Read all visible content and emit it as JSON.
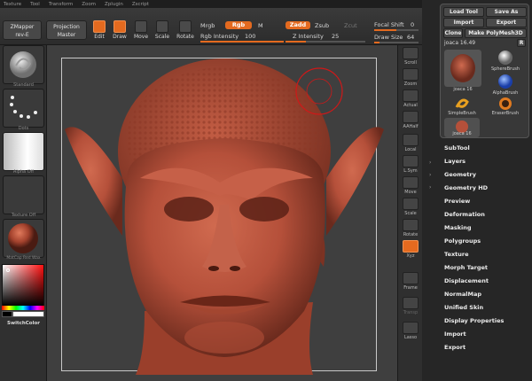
{
  "menubar": [
    "Texture",
    "Tool",
    "Transform",
    "Zoom",
    "Zplugin",
    "Zscript"
  ],
  "toolbar": {
    "zmapper": "ZMapper",
    "zmapper_sub": "rev-E",
    "projection": "Projection",
    "projection_sub": "Master",
    "edit": "Edit",
    "draw": "Draw",
    "move": "Move",
    "scale": "Scale",
    "rotate": "Rotate",
    "mrgb": "Mrgb",
    "rgb": "Rgb",
    "m": "M",
    "rgb_intensity_label": "Rgb Intensity",
    "rgb_intensity_value": "100",
    "rgb_intensity": 1.0,
    "zadd": "Zadd",
    "zsub": "Zsub",
    "zcut": "Zcut",
    "z_intensity_label": "Z Intensity",
    "z_intensity_value": "25",
    "z_intensity": 0.25,
    "focal_label": "Focal Shift",
    "focal_value": "0",
    "draw_size_label": "Draw Size",
    "draw_size_value": "64"
  },
  "leftshelf": {
    "brush_label": "Standard",
    "stroke_label": "Dots",
    "alpha_label": "Alpha Off",
    "texture_label": "Texture Off",
    "material_label": "MatCap Red Wax",
    "switch_color": "SwitchColor"
  },
  "rightshelf": {
    "items": [
      "Scroll",
      "Zoom",
      "Actual",
      "AAHalf",
      "Local",
      "L.Sym",
      "Move",
      "Scale",
      "Rotate",
      "Xyz",
      "Frame",
      "Transp",
      "Lasso"
    ]
  },
  "toolpanel": {
    "load_tool": "Load Tool",
    "save_as": "Save As",
    "import": "Import",
    "export": "Export",
    "clone": "Clone",
    "make_polymesh": "Make PolyMesh3D",
    "current_tool": "joaca 16.49",
    "r_button": "R",
    "tool_thumb_label": "joaca 16",
    "sphere_brush": "SphereBrush",
    "alpha_brush": "AlphaBrush",
    "simple_brush": "SimpleBrush",
    "eraser_brush": "EraserBrush",
    "small_thumb_label": "joaca 16",
    "menu": [
      "SubTool",
      "Layers",
      "Geometry",
      "Geometry HD",
      "Preview",
      "Deformation",
      "Masking",
      "Polygroups",
      "Texture",
      "Morph Target",
      "Displacement",
      "NormalMap",
      "Unified Skin",
      "Display Properties",
      "Import",
      "Export"
    ]
  },
  "colors": {
    "accent": "#e46a1f",
    "model": "#b5503a"
  }
}
